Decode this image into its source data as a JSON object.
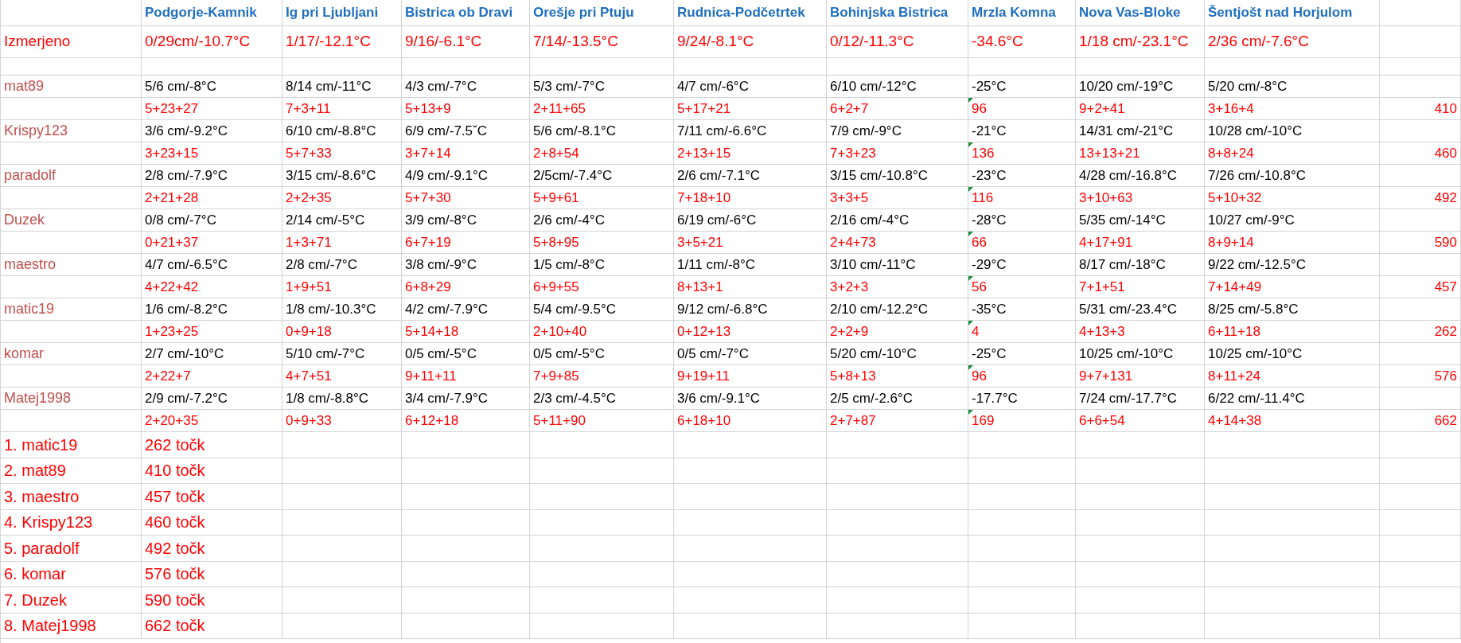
{
  "columns": [
    "Podgorje-Kamnik",
    "Ig pri Ljubljani",
    "Bistrica ob Dravi",
    "Orešje pri Ptuju",
    "Rudnica-Podčetrtek",
    "Bohinjska Bistrica",
    "Mrzla Komna",
    "Nova Vas-Bloke",
    "Šentjošt nad Horjulom"
  ],
  "measured": {
    "label": "Izmerjeno",
    "values": [
      "0/29cm/-10.7°C",
      "1/17/-12.1°C",
      "9/16/-6.1°C",
      "7/14/-13.5°C",
      "9/24/-8.1°C",
      "0/12/-11.3°C",
      "-34.6°C",
      "1/18 cm/-23.1°C",
      "2/36 cm/-7.6°C"
    ]
  },
  "players": [
    {
      "name": "mat89",
      "guesses": [
        "5/6 cm/-8°C",
        "8/14 cm/-11°C",
        "4/3 cm/-7°C",
        "5/3 cm/-7°C",
        "4/7 cm/-6°C",
        "6/10 cm/-12°C",
        "-25°C",
        "10/20 cm/-19°C",
        "5/20 cm/-8°C"
      ],
      "scores": [
        {
          "value": "5+23+27",
          "marked": false
        },
        {
          "value": "7+3+11",
          "marked": false
        },
        {
          "value": "5+13+9",
          "marked": false
        },
        {
          "value": "2+11+65",
          "marked": false
        },
        {
          "value": "5+17+21",
          "marked": false
        },
        {
          "value": "6+2+7",
          "marked": false
        },
        {
          "value": "96",
          "marked": true
        },
        {
          "value": "9+2+41",
          "marked": false
        },
        {
          "value": "3+16+4",
          "marked": false
        }
      ],
      "total": "410"
    },
    {
      "name": "Krispy123",
      "guesses": [
        "3/6 cm/-9.2°C",
        "6/10 cm/-8.8°C",
        "6/9 cm/-7.5ˇC",
        "5/6 cm/-8.1°C",
        "7/11 cm/-6.6°C",
        "7/9 cm/-9°C",
        "-21°C",
        "14/31 cm/-21°C",
        "10/28 cm/-10°C"
      ],
      "scores": [
        {
          "value": "3+23+15",
          "marked": false
        },
        {
          "value": "5+7+33",
          "marked": false
        },
        {
          "value": "3+7+14",
          "marked": false
        },
        {
          "value": "2+8+54",
          "marked": false
        },
        {
          "value": "2+13+15",
          "marked": false
        },
        {
          "value": "7+3+23",
          "marked": false
        },
        {
          "value": "136",
          "marked": true
        },
        {
          "value": "13+13+21",
          "marked": false
        },
        {
          "value": "8+8+24",
          "marked": false
        }
      ],
      "total": "460"
    },
    {
      "name": "paradolf",
      "guesses": [
        "2/8 cm/-7.9°C",
        "3/15 cm/-8.6°C",
        "4/9 cm/-9.1°C",
        "2/5cm/-7.4°C",
        "2/6 cm/-7.1°C",
        "3/15 cm/-10.8°C",
        "-23°C",
        "4/28 cm/-16.8°C",
        "7/26 cm/-10.8°C"
      ],
      "scores": [
        {
          "value": "2+21+28",
          "marked": false
        },
        {
          "value": "2+2+35",
          "marked": false
        },
        {
          "value": "5+7+30",
          "marked": false
        },
        {
          "value": "5+9+61",
          "marked": false
        },
        {
          "value": "7+18+10",
          "marked": false
        },
        {
          "value": "3+3+5",
          "marked": false
        },
        {
          "value": "116",
          "marked": true
        },
        {
          "value": "3+10+63",
          "marked": false
        },
        {
          "value": "5+10+32",
          "marked": false
        }
      ],
      "total": "492"
    },
    {
      "name": "Duzek",
      "guesses": [
        "0/8 cm/-7°C",
        "2/14 cm/-5°C",
        "3/9 cm/-8°C",
        "2/6 cm/-4°C",
        "6/19 cm/-6°C",
        "2/16 cm/-4°C",
        "-28°C",
        "5/35 cm/-14°C",
        "10/27 cm/-9°C"
      ],
      "scores": [
        {
          "value": "0+21+37",
          "marked": false
        },
        {
          "value": "1+3+71",
          "marked": false
        },
        {
          "value": "6+7+19",
          "marked": false
        },
        {
          "value": "5+8+95",
          "marked": false
        },
        {
          "value": "3+5+21",
          "marked": false
        },
        {
          "value": "2+4+73",
          "marked": false
        },
        {
          "value": "66",
          "marked": true
        },
        {
          "value": "4+17+91",
          "marked": false
        },
        {
          "value": "8+9+14",
          "marked": false
        }
      ],
      "total": "590"
    },
    {
      "name": "maestro",
      "guesses": [
        "4/7 cm/-6.5°C",
        "2/8 cm/-7°C",
        "3/8 cm/-9°C",
        "1/5 cm/-8°C",
        "1/11 cm/-8°C",
        "3/10 cm/-11°C",
        "-29°C",
        "8/17 cm/-18°C",
        "9/22 cm/-12.5°C"
      ],
      "scores": [
        {
          "value": "4+22+42",
          "marked": false
        },
        {
          "value": "1+9+51",
          "marked": false
        },
        {
          "value": "6+8+29",
          "marked": false
        },
        {
          "value": "6+9+55",
          "marked": false
        },
        {
          "value": "8+13+1",
          "marked": false
        },
        {
          "value": "3+2+3",
          "marked": false
        },
        {
          "value": "56",
          "marked": true
        },
        {
          "value": "7+1+51",
          "marked": false
        },
        {
          "value": "7+14+49",
          "marked": false
        }
      ],
      "total": "457"
    },
    {
      "name": "matic19",
      "guesses": [
        "1/6 cm/-8.2°C",
        "1/8 cm/-10.3°C",
        "4/2 cm/-7.9°C",
        "5/4 cm/-9.5°C",
        "9/12 cm/-6.8°C",
        "2/10 cm/-12.2°C",
        "-35°C",
        "5/31 cm/-23.4°C",
        "8/25 cm/-5.8°C"
      ],
      "scores": [
        {
          "value": "1+23+25",
          "marked": false
        },
        {
          "value": "0+9+18",
          "marked": false
        },
        {
          "value": "5+14+18",
          "marked": false
        },
        {
          "value": "2+10+40",
          "marked": false
        },
        {
          "value": "0+12+13",
          "marked": false
        },
        {
          "value": "2+2+9",
          "marked": false
        },
        {
          "value": "4",
          "marked": true
        },
        {
          "value": "4+13+3",
          "marked": false
        },
        {
          "value": "6+11+18",
          "marked": false
        }
      ],
      "total": "262"
    },
    {
      "name": "komar",
      "guesses": [
        "2/7 cm/-10°C",
        "5/10 cm/-7°C",
        "0/5 cm/-5°C",
        "0/5 cm/-5°C",
        "0/5 cm/-7°C",
        "5/20 cm/-10°C",
        "-25°C",
        "10/25 cm/-10°C",
        "10/25 cm/-10°C"
      ],
      "scores": [
        {
          "value": "2+22+7",
          "marked": false
        },
        {
          "value": "4+7+51",
          "marked": false
        },
        {
          "value": "9+11+11",
          "marked": false
        },
        {
          "value": "7+9+85",
          "marked": false
        },
        {
          "value": "9+19+11",
          "marked": false
        },
        {
          "value": "5+8+13",
          "marked": false
        },
        {
          "value": "96",
          "marked": true
        },
        {
          "value": "9+7+131",
          "marked": false
        },
        {
          "value": "8+11+24",
          "marked": false
        }
      ],
      "total": "576"
    },
    {
      "name": "Matej1998",
      "guesses": [
        "2/9 cm/-7.2°C",
        "1/8 cm/-8.8°C",
        "3/4 cm/-7.9°C",
        "2/3 cm/-4.5°C",
        "3/6 cm/-9.1°C",
        "2/5 cm/-2.6°C",
        "-17.7°C",
        "7/24 cm/-17.7°C",
        "6/22 cm/-11.4°C"
      ],
      "scores": [
        {
          "value": "2+20+35",
          "marked": false
        },
        {
          "value": "0+9+33",
          "marked": false
        },
        {
          "value": "6+12+18",
          "marked": false
        },
        {
          "value": "5+11+90",
          "marked": false
        },
        {
          "value": "6+18+10",
          "marked": false
        },
        {
          "value": "2+7+87",
          "marked": false
        },
        {
          "value": "169",
          "marked": true
        },
        {
          "value": "6+6+54",
          "marked": false
        },
        {
          "value": "4+14+38",
          "marked": false
        }
      ],
      "total": "662"
    }
  ],
  "ranking": [
    {
      "label": "1. matic19",
      "points": "262 točk"
    },
    {
      "label": "2. mat89",
      "points": "410 točk"
    },
    {
      "label": "3. maestro",
      "points": "457 točk"
    },
    {
      "label": "4. Krispy123",
      "points": "460 točk"
    },
    {
      "label": "5. paradolf",
      "points": "492 točk"
    },
    {
      "label": "6. komar",
      "points": "576 točk"
    },
    {
      "label": "7. Duzek",
      "points": "590 točk"
    },
    {
      "label": "8. Matej1998",
      "points": "662 točk"
    }
  ]
}
